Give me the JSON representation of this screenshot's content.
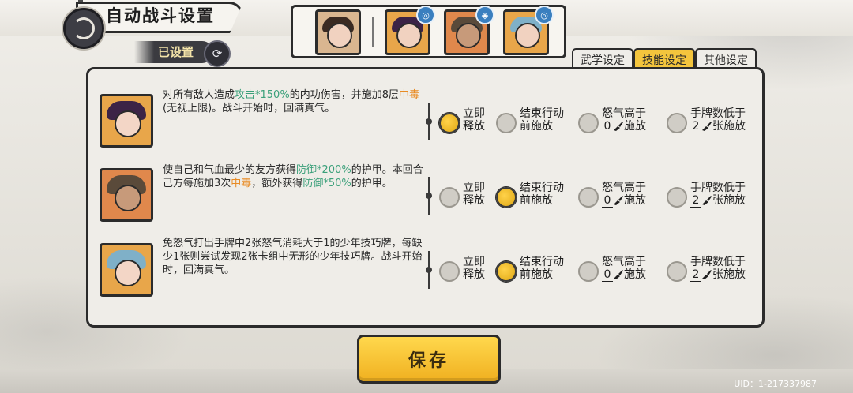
{
  "header": {
    "title": "自动战斗设置",
    "status": "已设置"
  },
  "tabs": [
    {
      "label": "武学设定",
      "active": false
    },
    {
      "label": "技能设定",
      "active": true
    },
    {
      "label": "其他设定",
      "active": false
    }
  ],
  "skills": [
    {
      "desc_parts": [
        {
          "text": "对所有敌人造成",
          "color": ""
        },
        {
          "text": "攻击*150%",
          "color": "green"
        },
        {
          "text": "的内功伤害，并施加8层",
          "color": ""
        },
        {
          "text": "中毒",
          "color": "orange"
        },
        {
          "text": "(无视上限)。战斗开始时，回满真气。",
          "color": ""
        }
      ],
      "selected": 0
    },
    {
      "desc_parts": [
        {
          "text": "使自己和气血最少的友方获得",
          "color": ""
        },
        {
          "text": "防御*200%",
          "color": "green"
        },
        {
          "text": "的护甲。本回合己方每施加3次",
          "color": ""
        },
        {
          "text": "中毒",
          "color": "orange"
        },
        {
          "text": "，额外获得",
          "color": ""
        },
        {
          "text": "防御*50%",
          "color": "green"
        },
        {
          "text": "的护甲。",
          "color": ""
        }
      ],
      "selected": 1
    },
    {
      "desc_parts": [
        {
          "text": "免怒气打出手牌中2张怒气消耗大于1的少年技巧牌，每缺少1张则尝试发现2张卡组中无形的少年技巧牌。战斗开始时，回满真气。",
          "color": ""
        }
      ],
      "selected": 1
    }
  ],
  "options": {
    "immediate_l1": "立即",
    "immediate_l2": "释放",
    "end_l1": "结束行动",
    "end_l2": "前施放",
    "rage_l1": "怒气高于",
    "rage_val": "0",
    "rage_l2": "施放",
    "hand_l1": "手牌数低于",
    "hand_val": "2",
    "hand_l2": "张施放"
  },
  "save_label": "保存",
  "uid": "UID：1-217337987",
  "colors": {
    "accent": "#f4c53d",
    "green_text": "#3ba07a",
    "orange_text": "#e88b24"
  }
}
